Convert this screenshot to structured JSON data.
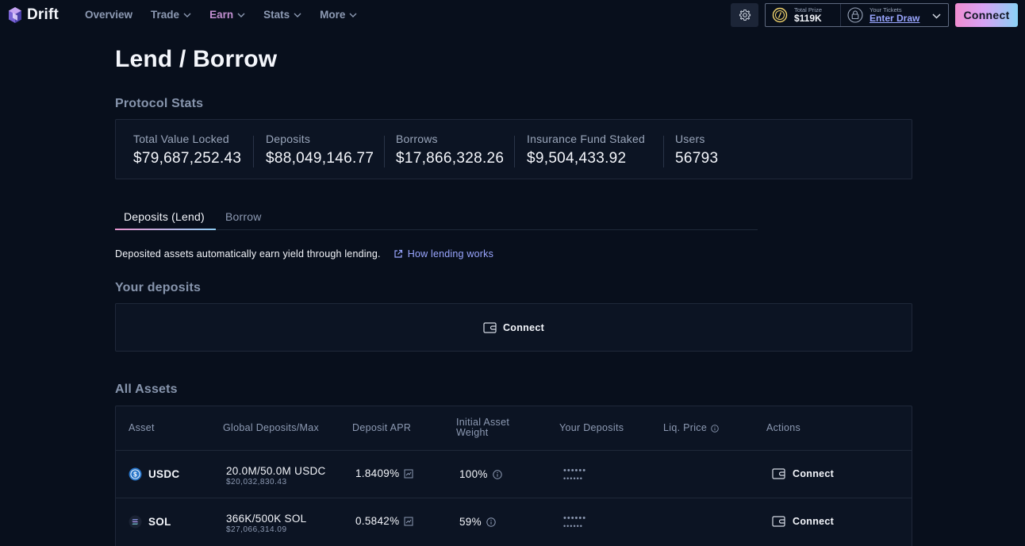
{
  "nav": {
    "brand": "Drift",
    "links": [
      {
        "label": "Overview"
      },
      {
        "label": "Trade"
      },
      {
        "label": "Earn"
      },
      {
        "label": "Stats"
      },
      {
        "label": "More"
      }
    ],
    "active_link": "Earn",
    "prize": {
      "label": "Total Prize",
      "value": "$119K"
    },
    "tickets": {
      "label": "Your Tickets",
      "value": "Enter Draw"
    },
    "connect_label": "Connect"
  },
  "page": {
    "title": "Lend / Borrow",
    "protocol_stats_title": "Protocol Stats",
    "stats": [
      {
        "label": "Total Value Locked",
        "value": "$79,687,252.43"
      },
      {
        "label": "Deposits",
        "value": "$88,049,146.77"
      },
      {
        "label": "Borrows",
        "value": "$17,866,328.26"
      },
      {
        "label": "Insurance Fund Staked",
        "value": "$9,504,433.92"
      },
      {
        "label": "Users",
        "value": "56793"
      }
    ],
    "tabs": [
      {
        "label": "Deposits (Lend)"
      },
      {
        "label": "Borrow"
      }
    ],
    "info_text": "Deposited assets automatically earn yield through lending.",
    "how_link": "How lending works",
    "your_deposits_title": "Your deposits",
    "deposits_connect": "Connect",
    "all_assets_title": "All Assets",
    "table": {
      "headers": {
        "asset": "Asset",
        "global": "Global Deposits/Max",
        "apr": "Deposit APR",
        "weight_1": "Initial Asset",
        "weight_2": "Weight",
        "your_deposits": "Your Deposits",
        "liq": "Liq. Price",
        "actions": "Actions"
      },
      "rows": [
        {
          "asset": "USDC",
          "global_main": "20.0M/50.0M USDC",
          "global_sub": "$20,032,830.43",
          "apr": "1.8409%",
          "weight": "100%",
          "deposit_mask_1": "••••••",
          "deposit_mask_2": "••••••",
          "action": "Connect"
        },
        {
          "asset": "SOL",
          "global_main": "366K/500K SOL",
          "global_sub": "$27,066,314.09",
          "apr": "0.5842%",
          "weight": "59%",
          "deposit_mask_1": "••••••",
          "deposit_mask_2": "••••••",
          "action": "Connect"
        }
      ]
    }
  },
  "colors": {
    "background": "#080f1c",
    "card": "#0c1423",
    "accent_pink": "#ef8dd0",
    "accent_blue": "#8ad2f5",
    "link": "#9aa6ff"
  }
}
